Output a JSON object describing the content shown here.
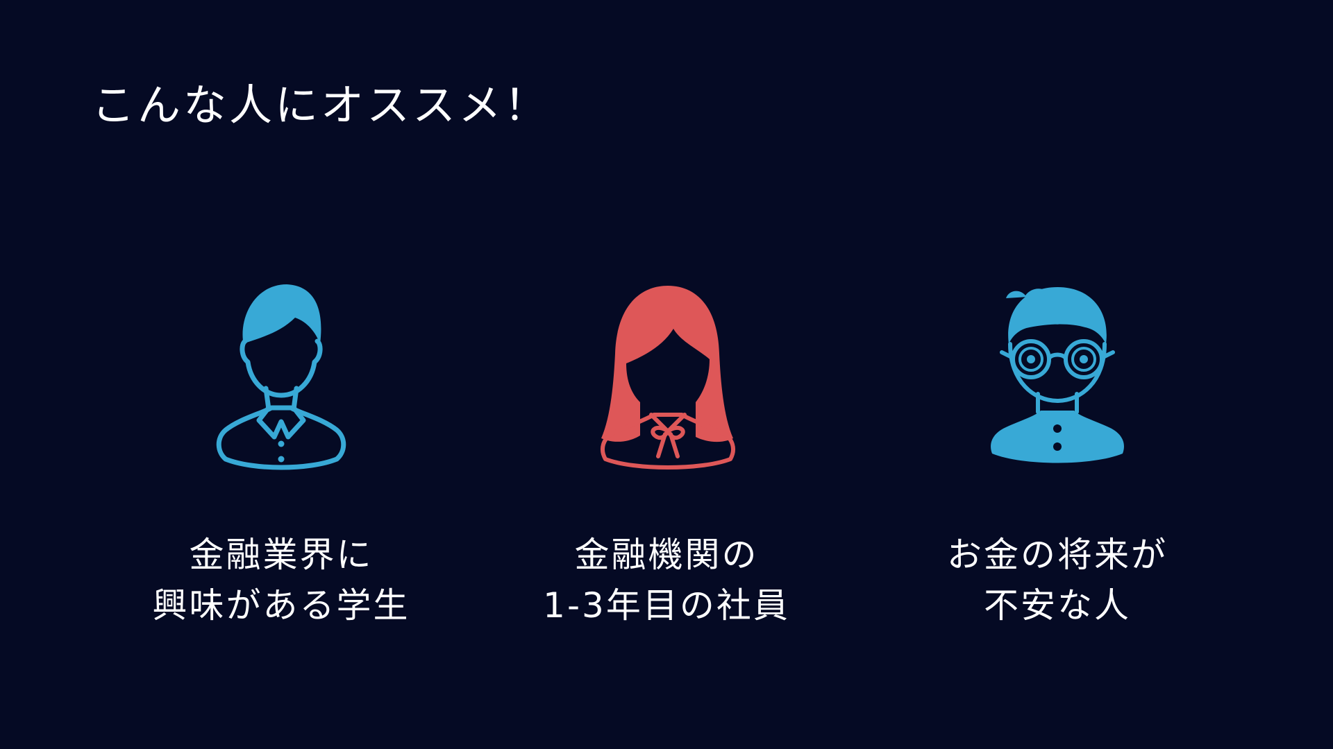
{
  "slide": {
    "title": "こんな人にオススメ！",
    "background_color": "#050a24",
    "accent_colors": {
      "blue": "#38a9d6",
      "red": "#de5758"
    }
  },
  "personas": [
    {
      "icon": "male-student-icon",
      "color": "#38a9d6",
      "line1": "金融業界に",
      "line2": "興味がある学生"
    },
    {
      "icon": "female-employee-icon",
      "color": "#de5758",
      "line1": "金融機関の",
      "line2": "1-3年目の社員"
    },
    {
      "icon": "anxious-man-with-swirly-glasses-icon",
      "color": "#38a9d6",
      "line1": "お金の将来が",
      "line2": "不安な人"
    }
  ]
}
